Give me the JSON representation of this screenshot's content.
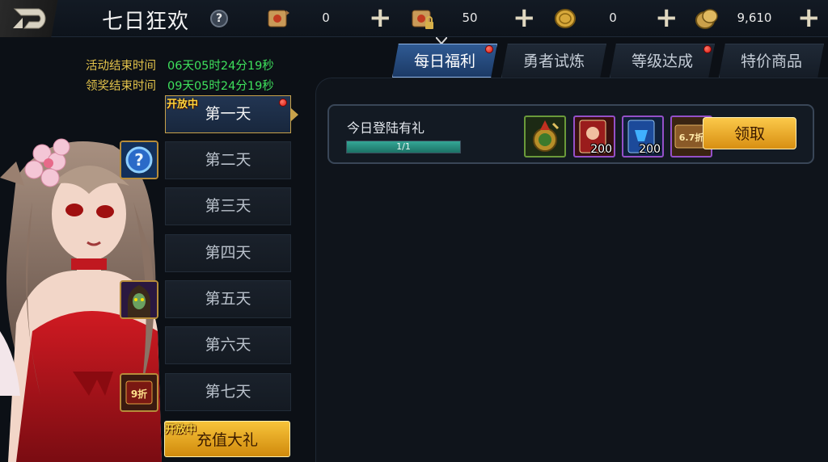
{
  "header": {
    "title": "七日狂欢",
    "help_icon": "help-icon",
    "resources": [
      {
        "icon": "scroll-icon",
        "value": "0"
      },
      {
        "icon": "locked-scroll-icon",
        "value": "50"
      },
      {
        "icon": "gold-coin-icon",
        "value": "0"
      },
      {
        "icon": "coin-stack-icon",
        "value": "9,610"
      }
    ]
  },
  "timers": {
    "event_end_label": "活动结束时间",
    "event_end_value": "06天05时24分19秒",
    "claim_end_label": "领奖结束时间",
    "claim_end_value": "09天05时24分19秒"
  },
  "days": [
    {
      "label": "第一天"
    },
    {
      "label": "第二天"
    },
    {
      "label": "第三天"
    },
    {
      "label": "第四天"
    },
    {
      "label": "第五天"
    },
    {
      "label": "第六天"
    },
    {
      "label": "第七天"
    }
  ],
  "open_badge": "开放中",
  "charge_button": "充值大礼",
  "day_reward_icons": [
    {
      "icon": "portrait-frame-blue-icon"
    },
    {
      "icon": "portrait-hooded-figure-icon"
    },
    {
      "icon": "discount-card-icon",
      "text": "9折"
    }
  ],
  "tabs": [
    {
      "label": "每日福利"
    },
    {
      "label": "勇者试炼"
    },
    {
      "label": "等级达成"
    },
    {
      "label": "特价商品"
    }
  ],
  "task": {
    "title": "今日登陆有礼",
    "progress_text": "1/1",
    "progress": 1.0,
    "claim_label": "领取",
    "rewards": [
      {
        "icon": "compass-medal-icon",
        "qty": ""
      },
      {
        "icon": "red-card-icon",
        "qty": "200"
      },
      {
        "icon": "blue-card-icon",
        "qty": "200"
      },
      {
        "icon": "discount-tag-icon",
        "qty": "",
        "text": "6.7折"
      }
    ]
  },
  "colors": {
    "accent_gold": "#c8a24a",
    "timer_label": "#e3c34b",
    "timer_value": "#3ee05c",
    "active_tab": "#2f5a93",
    "notification_dot": "#d8160c"
  }
}
